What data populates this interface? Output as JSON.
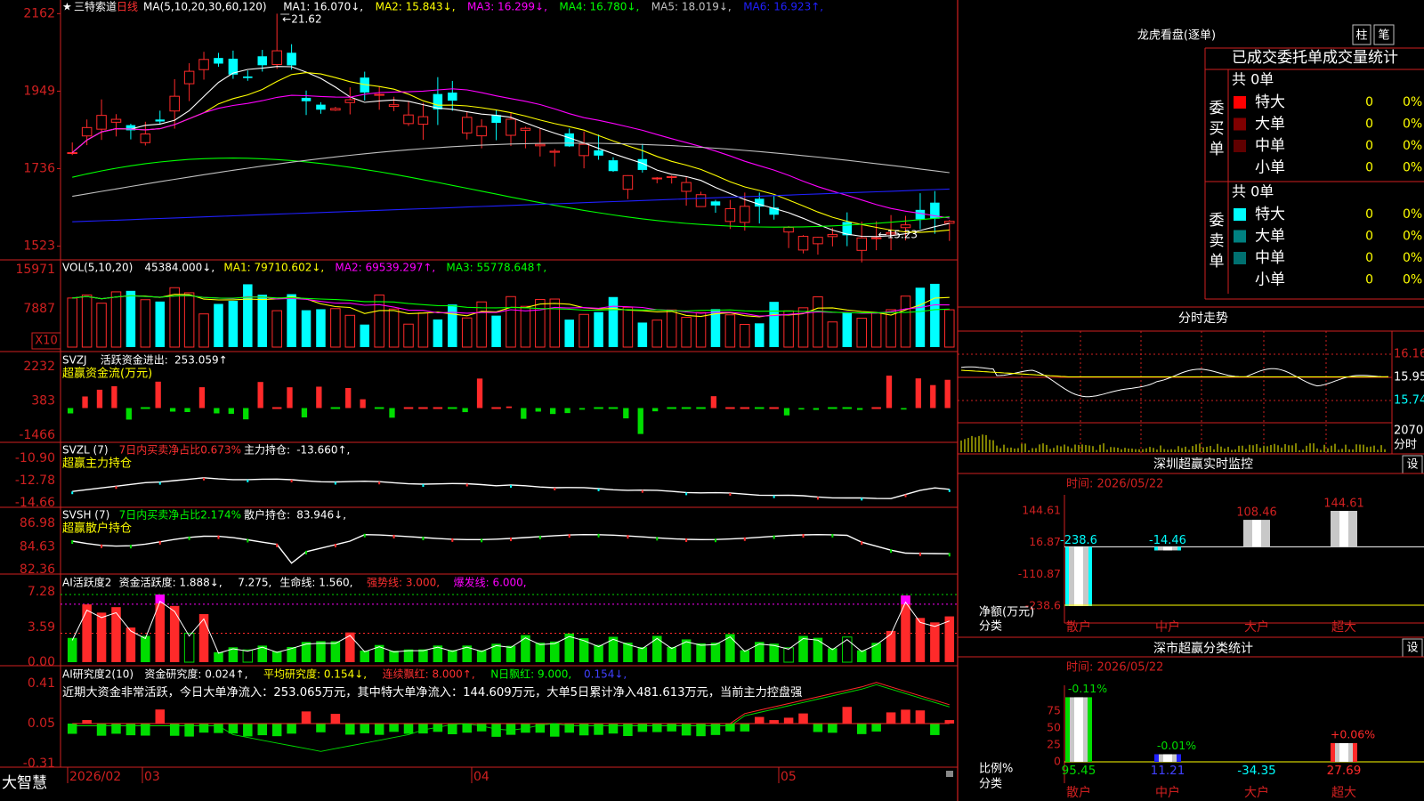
{
  "app": {
    "brand": "大智慧"
  },
  "colors": {
    "up": "#ff2a2a",
    "down": "#00ffff",
    "green": "#00dd00",
    "axis": "#d02020",
    "yellow": "#ffff00",
    "magenta": "#ff00ff"
  },
  "price_panel": {
    "star": "★",
    "stock_name": "三特索道",
    "period": "日线",
    "ma_label": "MA(5,10,20,30,60,120)",
    "ma_values": [
      {
        "label": "MA1:",
        "value": "16.070",
        "arrow": "↓",
        "color": "#ffffff"
      },
      {
        "label": "MA2:",
        "value": "15.843",
        "arrow": "↓",
        "color": "#ffff00"
      },
      {
        "label": "MA3:",
        "value": "16.299",
        "arrow": "↓",
        "color": "#ff00ff"
      },
      {
        "label": "MA4:",
        "value": "16.780",
        "arrow": "↓",
        "color": "#00ff00"
      },
      {
        "label": "MA5:",
        "value": "18.019",
        "arrow": "↓",
        "color": "#c0c0c0"
      },
      {
        "label": "MA6:",
        "value": "16.923",
        "arrow": "↑",
        "color": "#2020ff"
      }
    ],
    "y_ticks": [
      "2162",
      "1949",
      "1736",
      "1523"
    ],
    "high_label": "21.62",
    "low_label": "15.23"
  },
  "vol_panel": {
    "title": "VOL(5,10,20)",
    "value": "45384.000",
    "value_arrow": "↓",
    "ma_values": [
      {
        "label": "MA1:",
        "value": "79710.602",
        "arrow": "↓",
        "color": "#ffff00"
      },
      {
        "label": "MA2:",
        "value": "69539.297",
        "arrow": "↑",
        "color": "#ff00ff"
      },
      {
        "label": "MA3:",
        "value": "55778.648",
        "arrow": "↑",
        "color": "#00ff00"
      }
    ],
    "y_ticks": [
      "15971",
      "7887"
    ],
    "unit": "X10"
  },
  "svzj_panel": {
    "title": "SVZJ",
    "line1_label": "活跃资金进出:",
    "line1_value": "253.059",
    "line1_arrow": "↑",
    "subtitle": "超赢资金流(万元)",
    "y_ticks": [
      "2232",
      "383",
      "-1466"
    ]
  },
  "svzl_panel": {
    "title": "SVZL (7)",
    "ratio_label": "7日内买卖净占比0.673%",
    "hold_label": "主力持仓:",
    "hold_value": "-13.660",
    "hold_arrow": "↑",
    "subtitle": "超赢主力持仓",
    "y_ticks": [
      "-10.90",
      "-12.78",
      "-14.66"
    ]
  },
  "svsh_panel": {
    "title": "SVSH (7)",
    "ratio_label": "7日内买卖净占比2.174%",
    "hold_label": "散户持仓:",
    "hold_value": "83.946",
    "hold_arrow": "↓",
    "subtitle": "超赢散户持仓",
    "y_ticks": [
      "86.98",
      "84.63",
      "82.36"
    ]
  },
  "ai1_panel": {
    "title": "AI活跃度2",
    "items": [
      {
        "text": "资金活跃度: 1.888",
        "arrow": "↓",
        "color": "#ffffff"
      },
      {
        "text": "7.275",
        "arrow": "",
        "color": "#ffffff"
      },
      {
        "text": "生命线: 1.560",
        "arrow": "",
        "color": "#ffffff"
      },
      {
        "text": "强势线: 3.000",
        "arrow": "",
        "color": "#ff3030"
      },
      {
        "text": "爆发线: 6.000",
        "arrow": "",
        "color": "#ff00ff"
      }
    ],
    "y_ticks": [
      "7.28",
      "3.59",
      "0.00"
    ]
  },
  "ai2_panel": {
    "title": "AI研究度2(10)",
    "items": [
      {
        "text": "资金研究度: 0.024",
        "arrow": "↑",
        "color": "#ffffff"
      },
      {
        "text": "平均研究度: 0.154",
        "arrow": "↓",
        "color": "#ffff00"
      },
      {
        "text": "连续飘红: 8.000",
        "arrow": "↑",
        "color": "#ff3030"
      },
      {
        "text": "N日飘红: 9.000",
        "arrow": "",
        "color": "#00ff00"
      },
      {
        "text": "0.154",
        "arrow": "↓",
        "color": "#4040ff"
      }
    ],
    "comment": "近期大资金非常活跃，今日大单净流入：253.065万元，其中特大单净流入：144.609万元，大单5日累计净入481.613万元，当前主力控盘强",
    "y_ticks": [
      "0.41",
      "0.05",
      "-0.31"
    ]
  },
  "x_axis": {
    "labels": [
      "2026/02",
      "03",
      "04",
      "05"
    ]
  },
  "right_panel": {
    "lhb": {
      "title": "龙虎看盘(逐单)",
      "btn_zhu": "柱",
      "btn_bi": "笔",
      "header": "已成交委托单成交量统计",
      "buy_label": "委买单",
      "buy_total": "共 0单",
      "buy_rows": [
        {
          "name": "特大",
          "count": "0",
          "pct": "0%",
          "color": "#ff0000"
        },
        {
          "name": "大单",
          "count": "0",
          "pct": "0%",
          "color": "#800000"
        },
        {
          "name": "中单",
          "count": "0",
          "pct": "0%",
          "color": "#600000"
        },
        {
          "name": "小单",
          "count": "0",
          "pct": "0%",
          "color": ""
        }
      ],
      "sell_label": "委卖单",
      "sell_total": "共 0单",
      "sell_rows": [
        {
          "name": "特大",
          "count": "0",
          "pct": "0%",
          "color": "#00ffff"
        },
        {
          "name": "大单",
          "count": "0",
          "pct": "0%",
          "color": "#008080"
        },
        {
          "name": "中单",
          "count": "0",
          "pct": "0%",
          "color": "#007070"
        },
        {
          "name": "小单",
          "count": "0",
          "pct": "0%",
          "color": ""
        }
      ]
    },
    "intraday": {
      "title": "分时走势",
      "prices": [
        "16.16",
        "15.95",
        "15.74"
      ],
      "volume_label": "2070",
      "volume_unit": "分时"
    },
    "sz_monitor": {
      "title": "深圳超赢实时监控",
      "set": "设",
      "time": "时间: 2026/05/22",
      "y_ticks": [
        "144.61",
        "16.87",
        "-110.87",
        "-238.6"
      ],
      "unit_label": "净额(万元)",
      "cat_label": "分类",
      "categories": [
        "散户",
        "中户",
        "大户",
        "超大"
      ],
      "values": [
        -238.6,
        -14.46,
        108.46,
        144.61
      ],
      "value_labels": [
        "-238.6",
        "-14.46",
        "108.46",
        "144.61"
      ]
    },
    "sz_class": {
      "title": "深市超赢分类统计",
      "set": "设",
      "time": "时间: 2026/05/22",
      "y_ticks": [
        "75",
        "50",
        "25",
        "0"
      ],
      "unit_label": "比例%",
      "cat_label": "分类",
      "categories": [
        "散户",
        "中户",
        "大户",
        "超大"
      ],
      "values": [
        95.45,
        11.21,
        -34.35,
        27.69
      ],
      "value_labels": [
        "95.45",
        "11.21",
        "-34.35",
        "27.69"
      ],
      "change_labels": [
        "-0.11%",
        "-0.01%",
        "",
        "+0.06%"
      ]
    }
  }
}
